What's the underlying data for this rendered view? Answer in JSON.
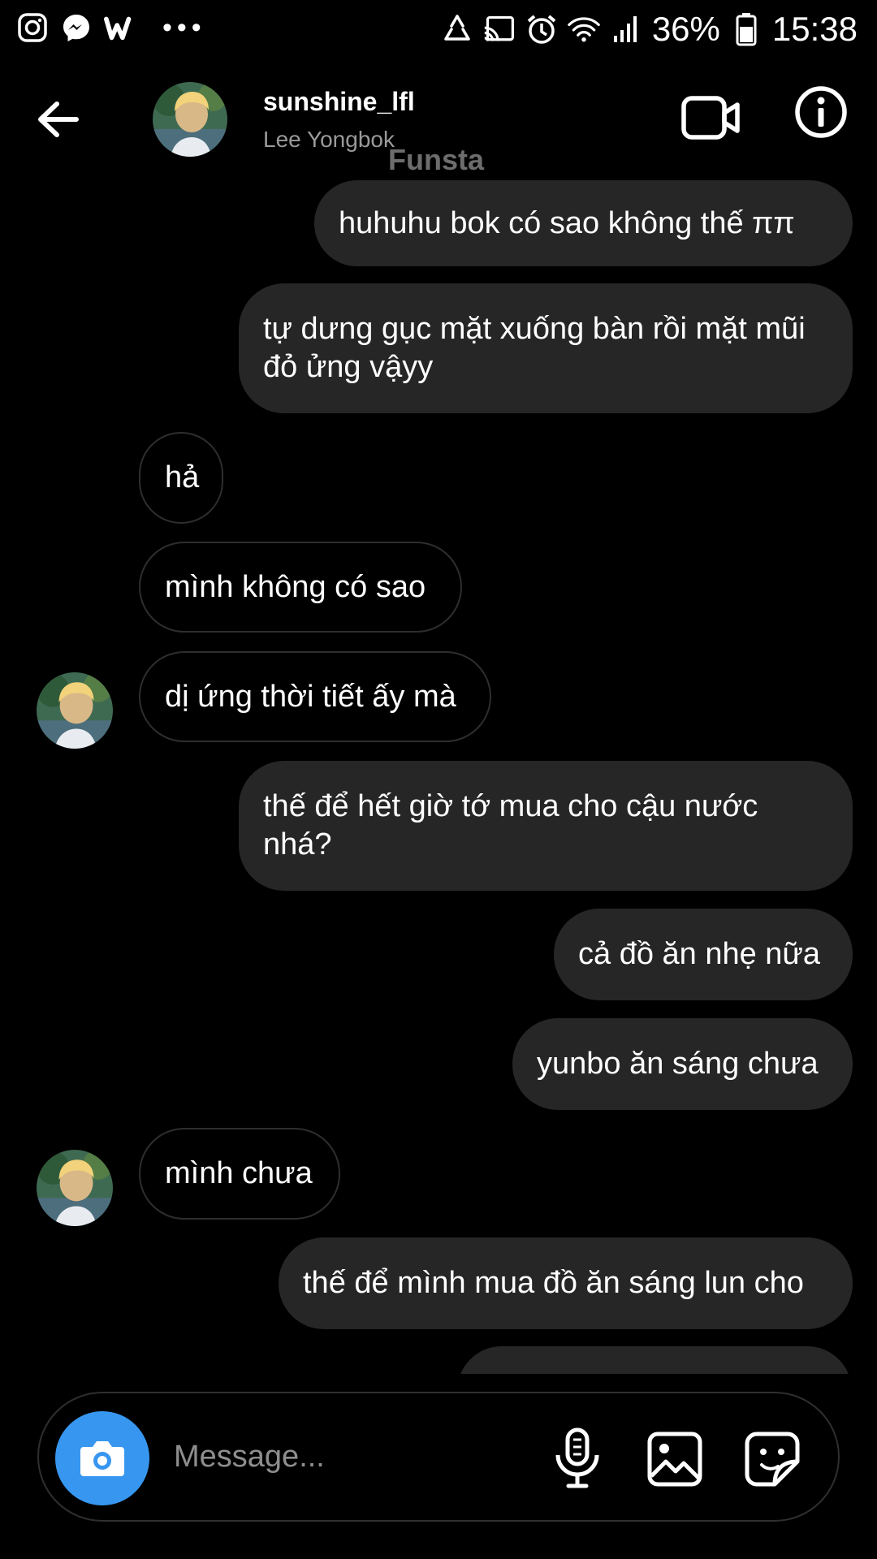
{
  "status_bar": {
    "battery": "36%",
    "time": "15:38",
    "overflow": "•••",
    "left_icons": [
      "instagram-icon",
      "messenger-icon",
      "w-app-icon"
    ],
    "right_icons": [
      "recycle-icon",
      "cast-icon",
      "alarm-icon",
      "wifi-icon",
      "signal-icon",
      "battery-icon"
    ]
  },
  "header": {
    "username": "sunshine_lfl",
    "subtitle": "Lee Yongbok",
    "watermark": "Funsta",
    "icons": [
      "back-arrow-icon",
      "video-camera-icon",
      "info-icon"
    ]
  },
  "messages": [
    {
      "side": "sent",
      "text": "huhuhu bok có sao không thế ππ"
    },
    {
      "side": "sent",
      "text": "tự dưng gục mặt xuống bàn rồi mặt mũi đỏ ửng vậyy"
    },
    {
      "side": "received",
      "text": "hả"
    },
    {
      "side": "received",
      "text": "mình không có sao"
    },
    {
      "side": "received",
      "text": "dị ứng thời tiết ấy mà",
      "avatar": true
    },
    {
      "side": "sent",
      "text": "thế để hết giờ tớ mua cho cậu nước nhá?"
    },
    {
      "side": "sent",
      "text": "cả đồ ăn nhẹ nữa"
    },
    {
      "side": "sent",
      "text": "yunbo ăn sáng chưa"
    },
    {
      "side": "received",
      "text": "mình chưa",
      "avatar": true
    },
    {
      "side": "sent",
      "text": "thế để mình mua đồ ăn sáng lun cho"
    }
  ],
  "composer": {
    "placeholder": "Message...",
    "icons": [
      "camera-icon",
      "microphone-icon",
      "gallery-icon",
      "sticker-icon"
    ]
  },
  "colors": {
    "background": "#000000",
    "sent_bubble": "#262626",
    "received_border": "#2e2e2e",
    "camera_button": "#3797f0",
    "subtitle_text": "#9a9a9a"
  }
}
